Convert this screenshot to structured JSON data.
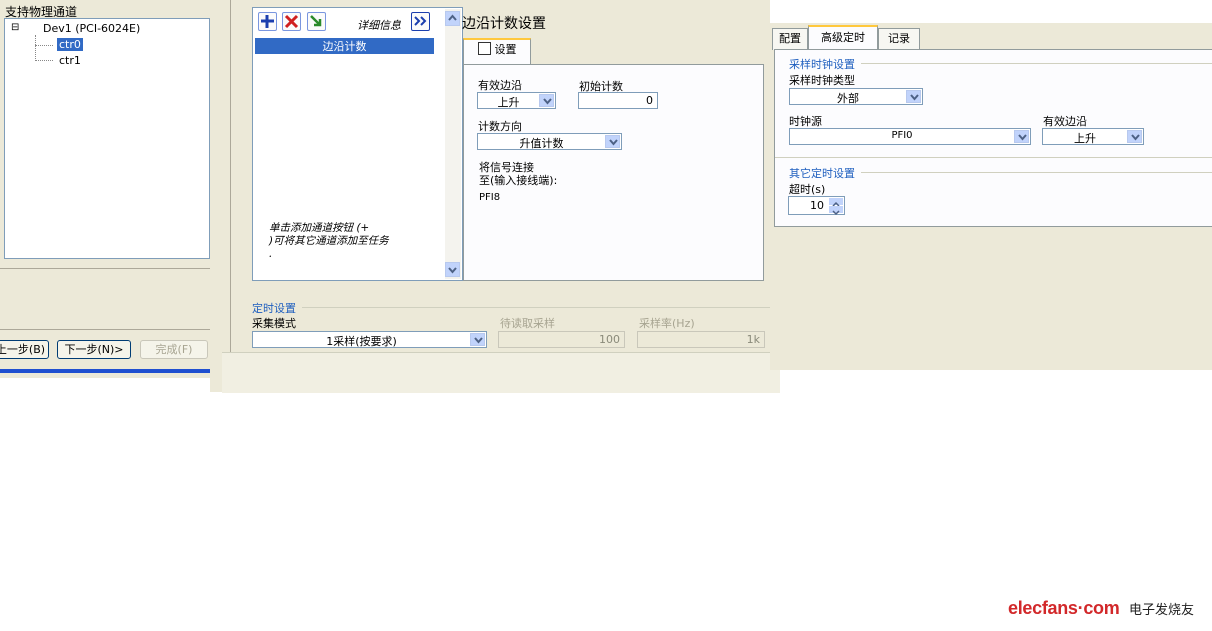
{
  "left_panel": {
    "header": "支持物理通道",
    "tree": {
      "expand_glyph": "⊟",
      "device": "Dev1 (PCI-6024E)",
      "channels": [
        "ctr0",
        "ctr1"
      ]
    },
    "nav": {
      "back": "上一步(B)",
      "next": "下一步(N)>",
      "finish": "完成(F)"
    }
  },
  "middle_panel": {
    "details_label": "详细信息",
    "channel_list": [
      "边沿计数"
    ],
    "hint": "单击添加通道按钮 (+)可将其它通道添加至任务",
    "hint_lines": [
      "单击添加通道按钮 (+",
      ")可将其它通道添加至任务",
      "."
    ],
    "title": "边沿计数设置",
    "tab": "设置",
    "active_edge_label": "有效边沿",
    "active_edge_value": "上升",
    "initial_count_label": "初始计数",
    "initial_count_value": "0",
    "count_dir_label": "计数方向",
    "count_dir_value": "升值计数",
    "connect_label_1": "将信号连接",
    "connect_label_2": "至(输入接线端):",
    "connect_value": "PFI8",
    "timing_title": "定时设置",
    "acq_mode_label": "采集模式",
    "acq_mode_value": "1采样(按要求)",
    "samples_label": "待读取采样",
    "samples_value": "100",
    "rate_label": "采样率(Hz)",
    "rate_value": "1k"
  },
  "right_panel": {
    "tabs": [
      "配置",
      "高级定时",
      "记录"
    ],
    "active_tab": "高级定时",
    "clock_group": "采样时钟设置",
    "clock_type_label": "采样时钟类型",
    "clock_type_value": "外部",
    "clock_source_label": "时钟源",
    "clock_source_value": "PFI0",
    "active_edge_label": "有效边沿",
    "active_edge_value": "上升",
    "other_group": "其它定时设置",
    "timeout_label": "超时(s)",
    "timeout_value": "10"
  },
  "watermark": {
    "brand": "elecfans·com",
    "cn": "电子发烧友"
  },
  "colors": {
    "panel_bg": "#ece9d8",
    "selection": "#316ac5",
    "group_title": "#1f5fbf",
    "watermark_red": "#d2282a"
  }
}
